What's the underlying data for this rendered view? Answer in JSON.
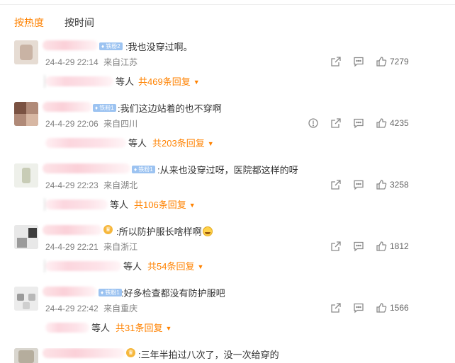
{
  "tabs": {
    "hot": "按热度",
    "time": "按时间"
  },
  "comments": [
    {
      "badge": "铁粉2",
      "text": ":我也没穿过啊。",
      "time": "24-4-29 22:14",
      "location": "来自江苏",
      "likes": "7279",
      "reply_suffix": "等人",
      "reply_link": "共469条回复"
    },
    {
      "badge": "铁粉1",
      "text": ":我们这边站着的也不穿啊",
      "time": "24-4-29 22:06",
      "location": "来自四川",
      "likes": "4235",
      "reply_suffix": "等人",
      "reply_link": "共203条回复"
    },
    {
      "badge": "铁粉1",
      "text": ":从来也没穿过呀，医院都这样的呀",
      "time": "24-4-29 22:23",
      "location": "来自湖北",
      "likes": "3258",
      "reply_suffix": "等人",
      "reply_link": "共106条回复"
    },
    {
      "badge": "",
      "text": ":所以防护服长啥样啊",
      "time": "24-4-29 22:21",
      "location": "来自浙江",
      "likes": "1812",
      "reply_suffix": "等人",
      "reply_link": "共54条回复"
    },
    {
      "badge": "铁粉1",
      "text": ":好多检查都没有防护服吧",
      "time": "24-4-29 22:42",
      "location": "来自重庆",
      "likes": "1566",
      "reply_suffix": "等人",
      "reply_link": "共31条回复"
    },
    {
      "badge": "",
      "text": ":三年半拍过八次了，没一次给穿的"
    }
  ]
}
